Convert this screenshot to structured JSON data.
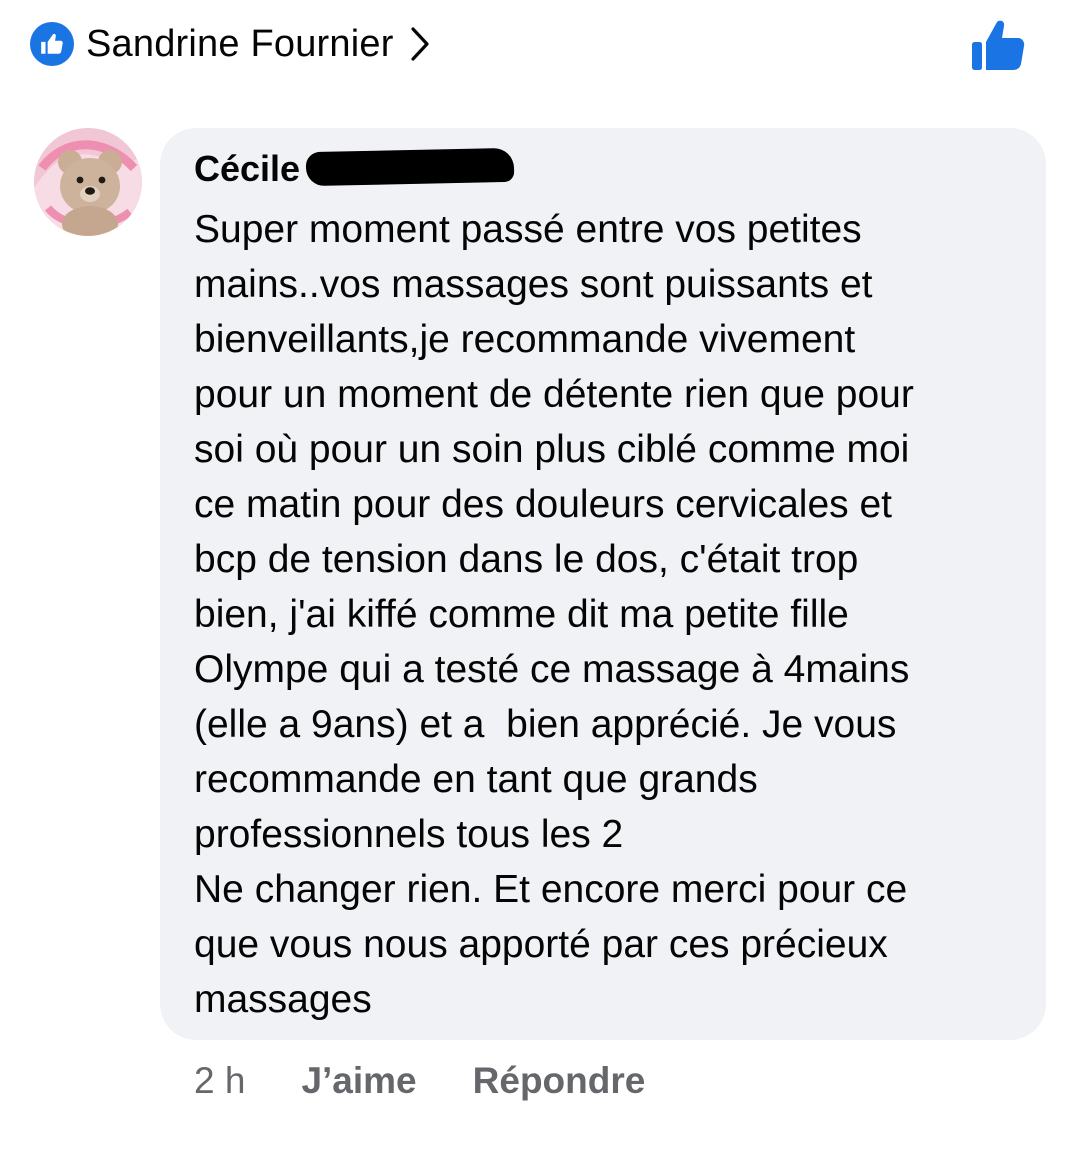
{
  "header": {
    "name": "Sandrine Fournier",
    "like_badge_icon": "thumbs-up-icon",
    "chevron_icon": "chevron-right-icon",
    "like_button_icon": "thumbs-up-icon",
    "accent_color": "#1b74e4"
  },
  "comment": {
    "author_visible": "Cécile",
    "avatar_icon": "teddy-bear-avatar",
    "lines": [
      "Super moment passé entre vos petites",
      "mains..vos massages sont puissants et",
      "bienveillants,je recommande vivement",
      "pour un moment de détente rien que pour",
      "soi où pour un soin plus ciblé comme moi",
      "ce matin pour des douleurs cervicales et",
      "bcp de tension dans le dos, c'était trop",
      "bien, j'ai kiffé comme dit ma petite fille",
      "Olympe qui a testé ce massage à 4mains",
      "(elle a 9ans) et a  bien apprécié. Je vous",
      "recommande en tant que grands",
      "professionnels tous les 2",
      "Ne changer rien. Et encore merci pour ce",
      "que vous nous apporté par ces précieux",
      "massages"
    ],
    "bubble_color": "#f0f2f5"
  },
  "actions": {
    "time": "2 h",
    "like": "J’aime",
    "reply": "Répondre",
    "muted_color": "#65676b"
  }
}
